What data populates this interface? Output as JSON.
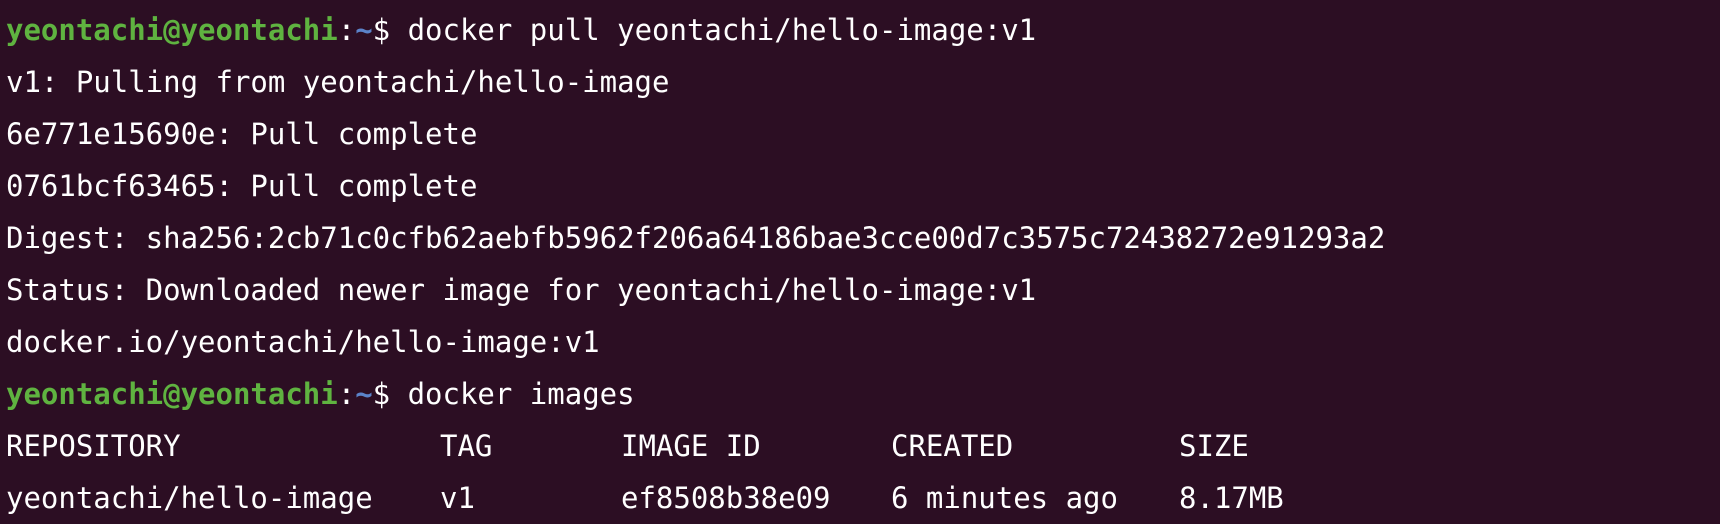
{
  "prompt": {
    "user_host": "yeontachi@yeontachi",
    "colon": ":",
    "path": "~",
    "dollar": "$ "
  },
  "commands": {
    "pull": "docker pull yeontachi/hello-image:v1",
    "images": "docker images"
  },
  "pull_output": [
    "v1: Pulling from yeontachi/hello-image",
    "6e771e15690e: Pull complete",
    "0761bcf63465: Pull complete",
    "Digest: sha256:2cb71c0cfb62aebfb5962f206a64186bae3cce00d7c3575c72438272e91293a2",
    "Status: Downloaded newer image for yeontachi/hello-image:v1",
    "docker.io/yeontachi/hello-image:v1"
  ],
  "images_table": {
    "headers": [
      "REPOSITORY",
      "TAG",
      "IMAGE ID",
      "CREATED",
      "SIZE"
    ],
    "rows": [
      [
        "yeontachi/hello-image",
        "v1",
        "ef8508b38e09",
        "6 minutes ago",
        "8.17MB"
      ]
    ]
  },
  "colors": {
    "background": "#2c0e23",
    "user_host": "#5fb340",
    "path": "#5b83c9",
    "text": "#ffffff"
  }
}
